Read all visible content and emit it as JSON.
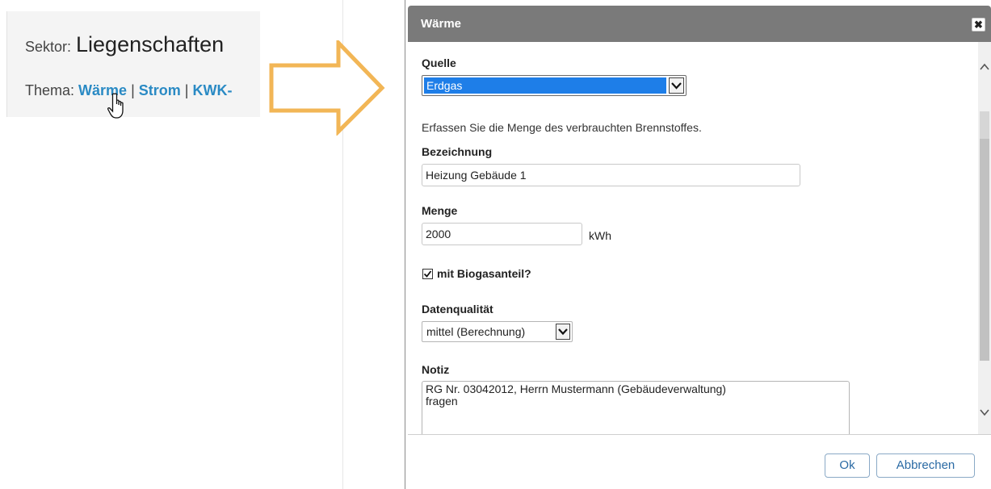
{
  "left": {
    "sektor_label": "Sektor:",
    "sektor_value": "Liegenschaften",
    "thema_label": "Thema:",
    "thema_links": [
      "Wärme",
      "Strom",
      "KWK-"
    ],
    "thema_separator": "|"
  },
  "dialog": {
    "title": "Wärme",
    "close_symbol": "✖",
    "quelle": {
      "label": "Quelle",
      "value": "Erdgas"
    },
    "hint": "Erfassen Sie die Menge des verbrauchten Brennstoffes.",
    "bezeichnung": {
      "label": "Bezeichnung",
      "value": "Heizung Gebäude 1"
    },
    "menge": {
      "label": "Menge",
      "value": "2000",
      "unit": "kWh"
    },
    "biogas": {
      "label": "mit Biogasanteil?",
      "checked": true
    },
    "datenqualitaet": {
      "label": "Datenqualität",
      "value": "mittel (Berechnung)"
    },
    "notiz": {
      "label": "Notiz",
      "value": "RG Nr. 03042012, Herrn Mustermann (Gebäudeverwaltung)\nfragen"
    },
    "ok_label": "Ok",
    "cancel_label": "Abbrechen"
  },
  "colors": {
    "header_bg": "#7a7a7a",
    "link": "#2a8ac4",
    "selection": "#1e7ee8",
    "arrow_stroke": "#f2b656",
    "button_text": "#2a6aa4"
  },
  "icons": {
    "cursor": "hand-pointer-icon",
    "arrow": "right-arrow-icon",
    "close": "close-icon",
    "dropdown": "chevron-down-icon",
    "check": "checkmark-icon"
  }
}
